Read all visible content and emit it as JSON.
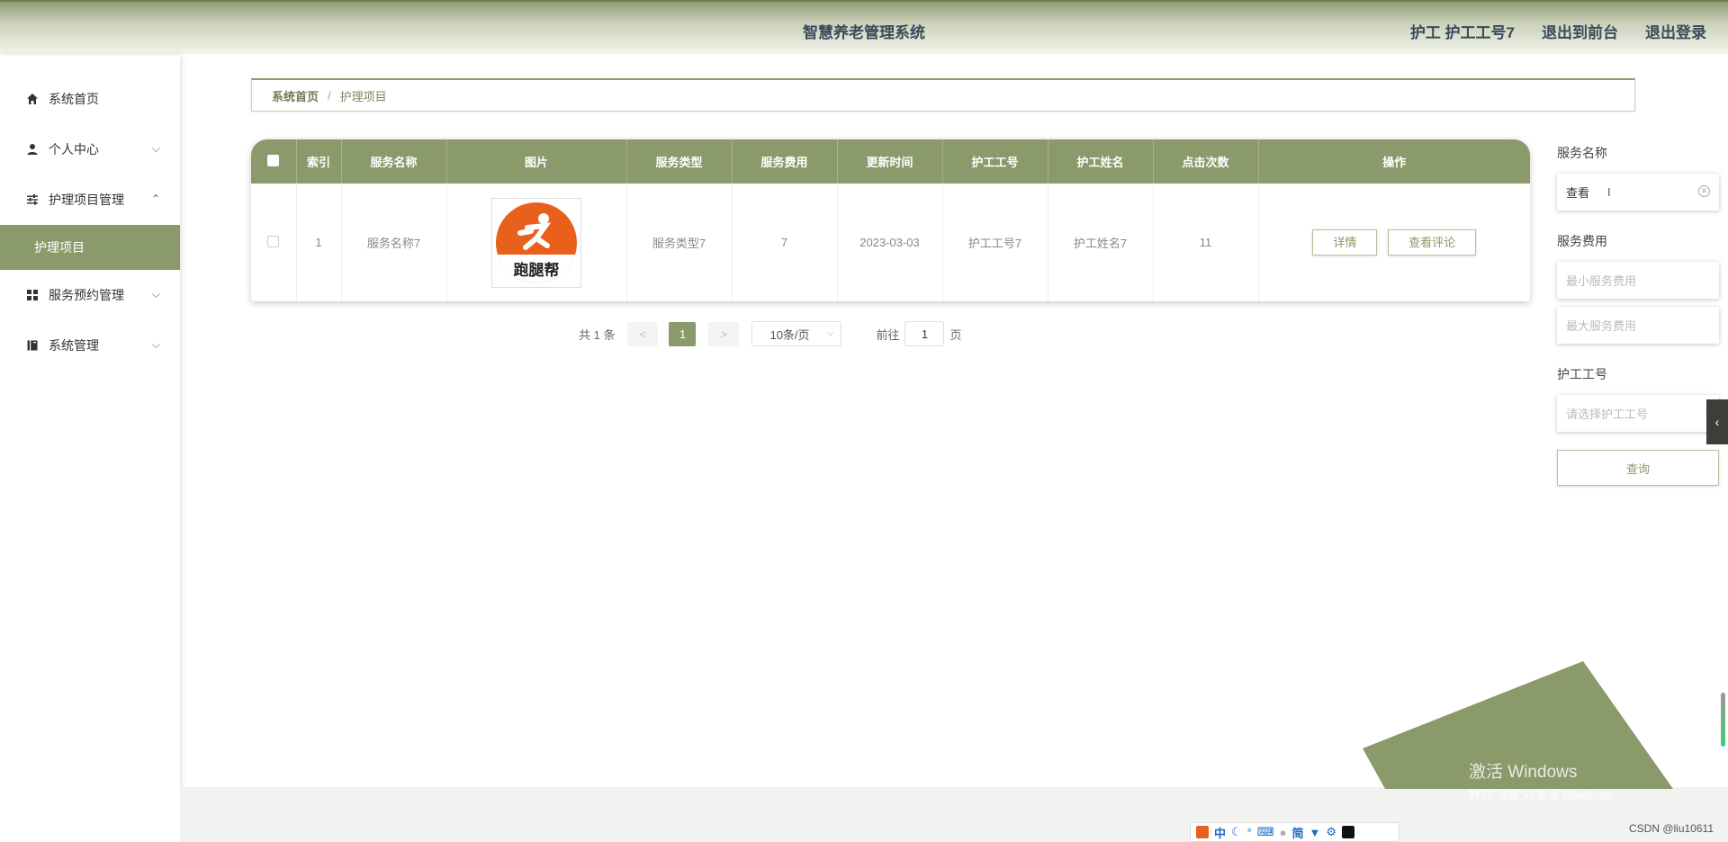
{
  "header": {
    "title": "智慧养老管理系统",
    "user": "护工 护工工号7",
    "front": "退出到前台",
    "logout": "退出登录"
  },
  "sidebar": {
    "items": [
      {
        "label": "系统首页",
        "icon": "home-icon"
      },
      {
        "label": "个人中心",
        "icon": "user-icon"
      },
      {
        "label": "护理项目管理",
        "icon": "sliders-icon"
      },
      {
        "label": "护理项目",
        "icon": ""
      },
      {
        "label": "服务预约管理",
        "icon": "grid-icon"
      },
      {
        "label": "系统管理",
        "icon": "book-icon"
      }
    ]
  },
  "breadcrumb": {
    "home": "系统首页",
    "sep": "/",
    "current": "护理项目"
  },
  "table": {
    "headers": [
      "索引",
      "服务名称",
      "图片",
      "服务类型",
      "服务费用",
      "更新时间",
      "护工工号",
      "护工姓名",
      "点击次数",
      "操作"
    ],
    "rows": [
      {
        "index": "1",
        "name": "服务名称7",
        "image_text": "跑腿帮",
        "type": "服务类型7",
        "fee": "7",
        "updated": "2023-03-03",
        "worker_no": "护工工号7",
        "worker_name": "护工姓名7",
        "clicks": "11",
        "btn_detail": "详情",
        "btn_comments": "查看评论"
      }
    ]
  },
  "pager": {
    "total": "共 1 条",
    "prev": "<",
    "page": "1",
    "next": ">",
    "size": "10条/页",
    "goto": "前往",
    "goto_value": "1",
    "goto_unit": "页"
  },
  "search": {
    "name_label": "服务名称",
    "name_value": "查看",
    "fee_label": "服务费用",
    "fee_min_placeholder": "最小服务费用",
    "fee_max_placeholder": "最大服务费用",
    "worker_label": "护工工号",
    "worker_placeholder": "请选择护工工号",
    "query_button": "查询"
  },
  "watermark": {
    "line1": "激活 Windows",
    "line2": "转到\"设置\"以激活 Windows。"
  },
  "csdn": "CSDN @liu10611",
  "ime": {
    "lang": "中",
    "simp": "简"
  },
  "colors": {
    "accent": "#8a9a6a",
    "header_text": "#3a4a5a"
  }
}
